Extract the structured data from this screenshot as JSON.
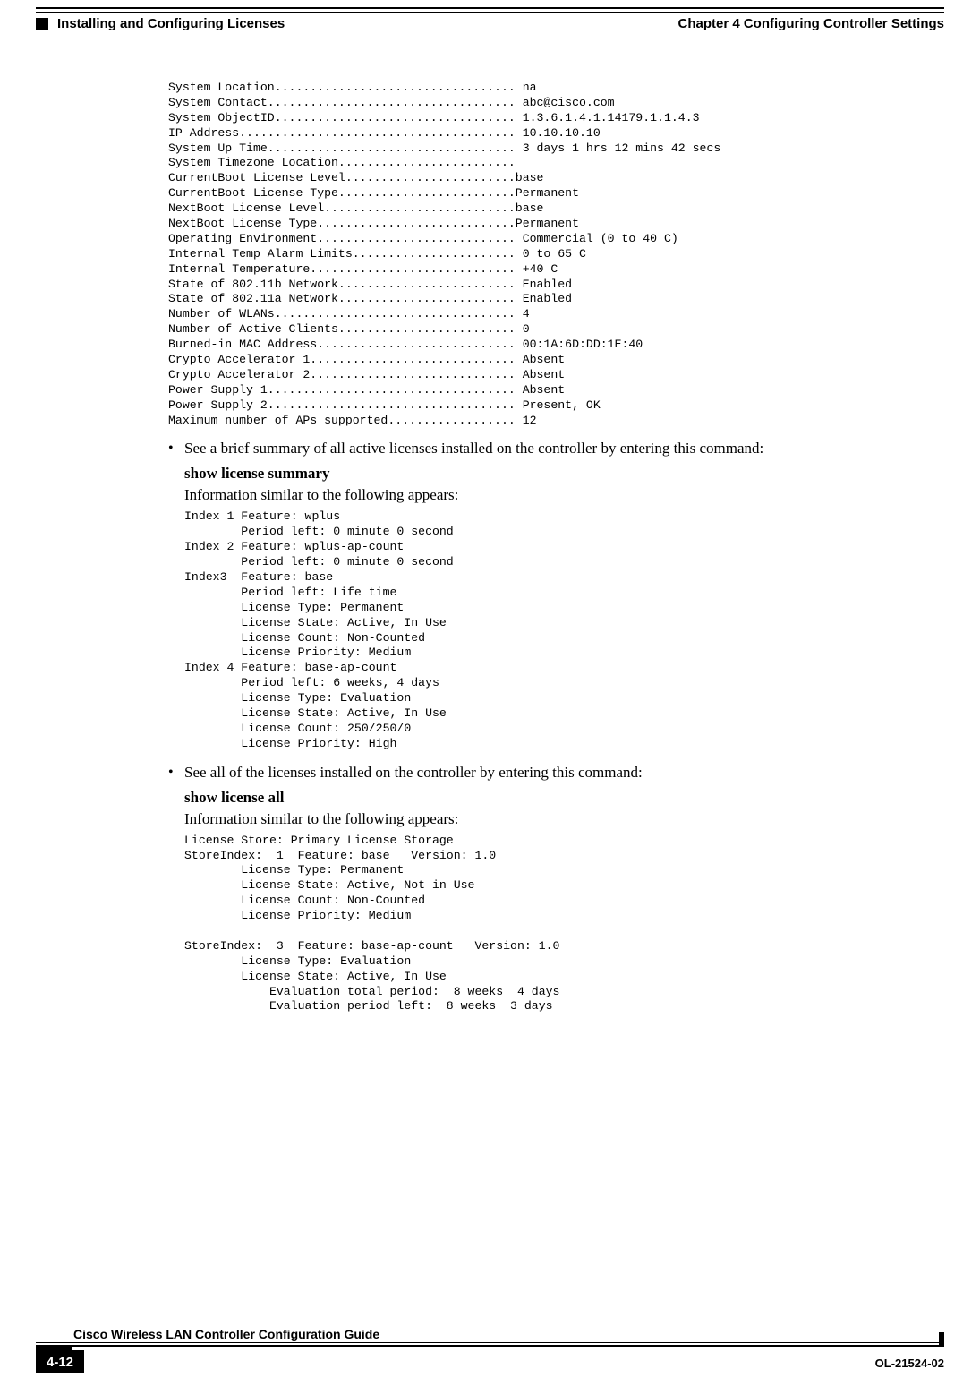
{
  "header": {
    "chapter_label": "Chapter 4      Configuring Controller Settings",
    "section_label": "Installing and Configuring Licenses"
  },
  "sysinfo_block": "System Location.................................. na\nSystem Contact................................... abc@cisco.com\nSystem ObjectID.................................. 1.3.6.1.4.1.14179.1.1.4.3\nIP Address....................................... 10.10.10.10\nSystem Up Time................................... 3 days 1 hrs 12 mins 42 secs\nSystem Timezone Location......................... \nCurrentBoot License Level........................base\nCurrentBoot License Type.........................Permanent\nNextBoot License Level...........................base\nNextBoot License Type............................Permanent\nOperating Environment............................ Commercial (0 to 40 C)\nInternal Temp Alarm Limits....................... 0 to 65 C\nInternal Temperature............................. +40 C\nState of 802.11b Network......................... Enabled\nState of 802.11a Network......................... Enabled\nNumber of WLANs.................................. 4\nNumber of Active Clients......................... 0\nBurned-in MAC Address............................ 00:1A:6D:DD:1E:40\nCrypto Accelerator 1............................. Absent\nCrypto Accelerator 2............................. Absent\nPower Supply 1................................... Absent\nPower Supply 2................................... Present, OK\nMaximum number of APs supported.................. 12",
  "bullets": {
    "b1_text": "See a brief summary of all active licenses installed on the controller by entering this command:",
    "b1_cmd": "show license summary",
    "b1_caption": "Information similar to the following appears:",
    "b1_output": "Index 1 Feature: wplus\n        Period left: 0 minute 0 second\nIndex 2 Feature: wplus-ap-count\n        Period left: 0 minute 0 second\nIndex3  Feature: base\n        Period left: Life time\n        License Type: Permanent\n        License State: Active, In Use\n        License Count: Non-Counted\n        License Priority: Medium\nIndex 4 Feature: base-ap-count\n        Period left: 6 weeks, 4 days\n        License Type: Evaluation\n        License State: Active, In Use\n        License Count: 250/250/0\n        License Priority: High",
    "b2_text": "See all of the licenses installed on the controller by entering this command:",
    "b2_cmd": "show license all",
    "b2_caption": "Information similar to the following appears:",
    "b2_output": "License Store: Primary License Storage\nStoreIndex:  1  Feature: base   Version: 1.0\n        License Type: Permanent\n        License State: Active, Not in Use\n        License Count: Non-Counted\n        License Priority: Medium\n\nStoreIndex:  3  Feature: base-ap-count   Version: 1.0\n        License Type: Evaluation\n        License State: Active, In Use\n            Evaluation total period:  8 weeks  4 days\n            Evaluation period left:  8 weeks  3 days"
  },
  "footer": {
    "doc_title": "Cisco Wireless LAN Controller Configuration Guide",
    "page_num": "4-12",
    "doc_id": "OL-21524-02"
  }
}
